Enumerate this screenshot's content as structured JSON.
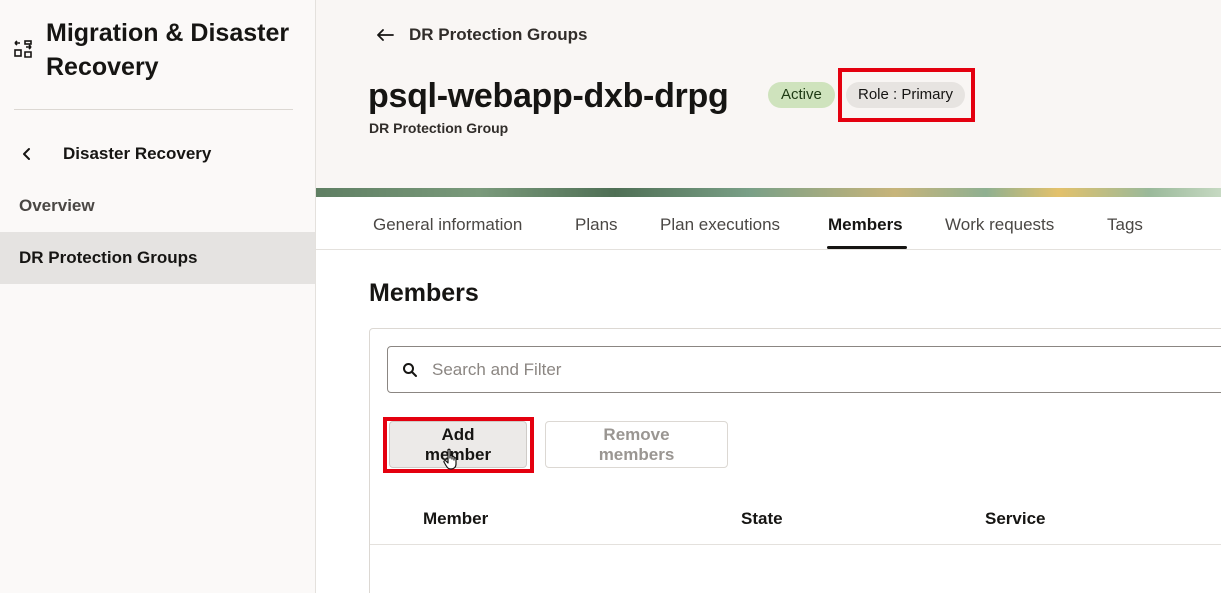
{
  "sidebar": {
    "app_icon": "migration-icon",
    "title": "Migration & Disaster Recovery",
    "back_label": "Disaster Recovery",
    "back_icon": "chevron-left-icon",
    "items": [
      {
        "label": "Overview",
        "active": false
      },
      {
        "label": "DR Protection Groups",
        "active": true
      }
    ]
  },
  "header": {
    "breadcrumb_icon": "arrow-left-icon",
    "breadcrumb": "DR Protection Groups",
    "title": "psql-webapp-dxb-drpg",
    "subtitle": "DR Protection Group",
    "status_badge": "Active",
    "role_badge": "Role : Primary"
  },
  "tabs": [
    {
      "label": "General information",
      "active": false
    },
    {
      "label": "Plans",
      "active": false
    },
    {
      "label": "Plan executions",
      "active": false
    },
    {
      "label": "Members",
      "active": true
    },
    {
      "label": "Work requests",
      "active": false
    },
    {
      "label": "Tags",
      "active": false
    }
  ],
  "members": {
    "section_title": "Members",
    "search": {
      "placeholder": "Search and Filter",
      "value": "",
      "icon": "search-icon"
    },
    "add_button": "Add member",
    "remove_button": "Remove members",
    "columns": [
      "Member",
      "State",
      "Service"
    ],
    "rows": []
  },
  "colors": {
    "highlight": "#e4000f",
    "active_badge_bg": "#cfe3bd",
    "role_badge_bg": "#e7e4e1",
    "sidebar_active_bg": "#e5e3e1"
  }
}
